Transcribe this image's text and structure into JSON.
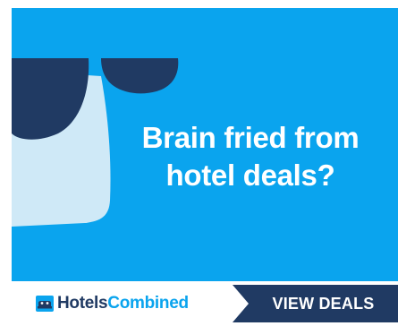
{
  "ad": {
    "headline_line1": "Brain fried from",
    "headline_line2": "hotel deals?",
    "brand_part1": "Hotels",
    "brand_part2": "Combined",
    "cta_label": "VIEW DEALS"
  },
  "colors": {
    "sky_blue": "#0aa4ee",
    "navy": "#203a63",
    "light_blue": "#cfe9f7",
    "white": "#ffffff"
  },
  "icons": [
    "sunglasses-face-illustration",
    "hotelscombined-logo-icon"
  ]
}
